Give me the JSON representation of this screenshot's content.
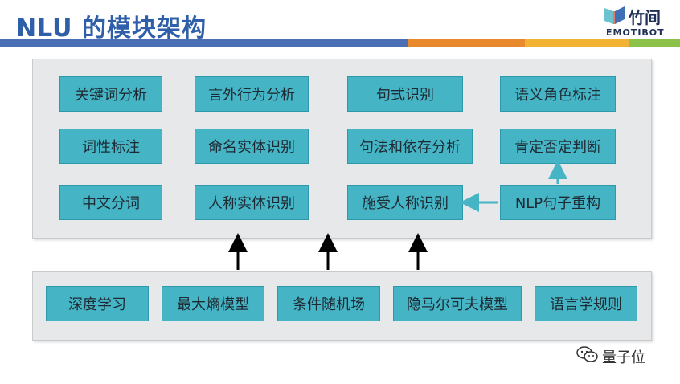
{
  "title": "NLU 的模块架构",
  "logo": {
    "name": "竹间",
    "subtitle": "EMOTIBOT"
  },
  "colors": {
    "title": "#2f5fa8",
    "box_fill": "#45b5c6",
    "box_border": "#2f98aa",
    "panel_fill": "#e7e8ea",
    "divider": [
      "#4a6fb5",
      "#e8892c",
      "#f2b233",
      "#8cc24a"
    ],
    "arrow_black": "#000000",
    "arrow_teal": "#45b5c6"
  },
  "nlu_modules": [
    "关键词分析",
    "言外行为分析",
    "句式识别",
    "语义角色标注",
    "词性标注",
    "命名实体识别",
    "句法和依存分析",
    "肯定否定判断",
    "中文分词",
    "人称实体识别",
    "施受人称识别",
    "NLP句子重构"
  ],
  "techniques": [
    "深度学习",
    "最大熵模型",
    "条件随机场",
    "隐马尔可夫模型",
    "语言学规则"
  ],
  "watermark": {
    "icon": "wechat-icon",
    "text": "量子位"
  }
}
